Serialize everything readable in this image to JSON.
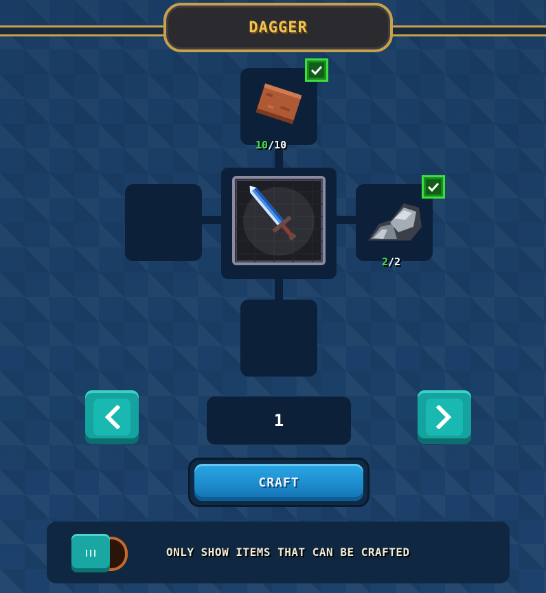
{
  "title": "DAGGER",
  "recipe": {
    "center_item": {
      "name": "sword-icon"
    },
    "slots": [
      {
        "position": "top",
        "icon": "leather-icon",
        "have": "10",
        "need": "10",
        "ready": true
      },
      {
        "position": "right",
        "icon": "iron-ore-icon",
        "have": "2",
        "need": "2",
        "ready": true
      },
      {
        "position": "left",
        "icon": "",
        "empty": true
      },
      {
        "position": "bottom",
        "icon": "",
        "empty": true
      }
    ]
  },
  "quantity": "1",
  "craft_label": "CRAFT",
  "filter": {
    "label": "ONLY SHOW ITEMS THAT CAN BE CRAFTED",
    "enabled": false
  },
  "colors": {
    "accent_gold": "#c9a14a",
    "ready_green": "#39e23a",
    "button_teal": "#14a39e",
    "craft_blue": "#1e8ccc"
  }
}
